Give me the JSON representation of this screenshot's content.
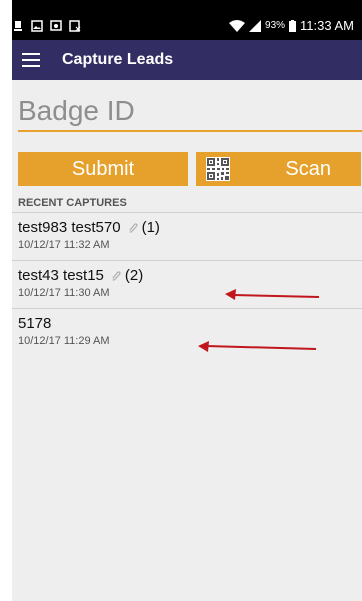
{
  "status_bar": {
    "battery": "93%",
    "time": "11:33 AM"
  },
  "app_bar": {
    "title": "Capture Leads"
  },
  "badge_field": {
    "placeholder": "Badge ID"
  },
  "buttons": {
    "submit_label": "Submit",
    "scan_label": "Scan"
  },
  "recent": {
    "heading": "RECENT CAPTURES",
    "items": [
      {
        "name": "test983 test570",
        "count": "(1)",
        "time": "10/12/17 11:32 AM"
      },
      {
        "name": "test43 test15",
        "count": "(2)",
        "time": "10/12/17 11:30 AM"
      },
      {
        "name": "5178",
        "count": "",
        "time": "10/12/17 11:29 AM"
      }
    ]
  },
  "colors": {
    "app_bar": "#322e63",
    "accent": "#e5a12c",
    "arrow": "#c0161c"
  }
}
